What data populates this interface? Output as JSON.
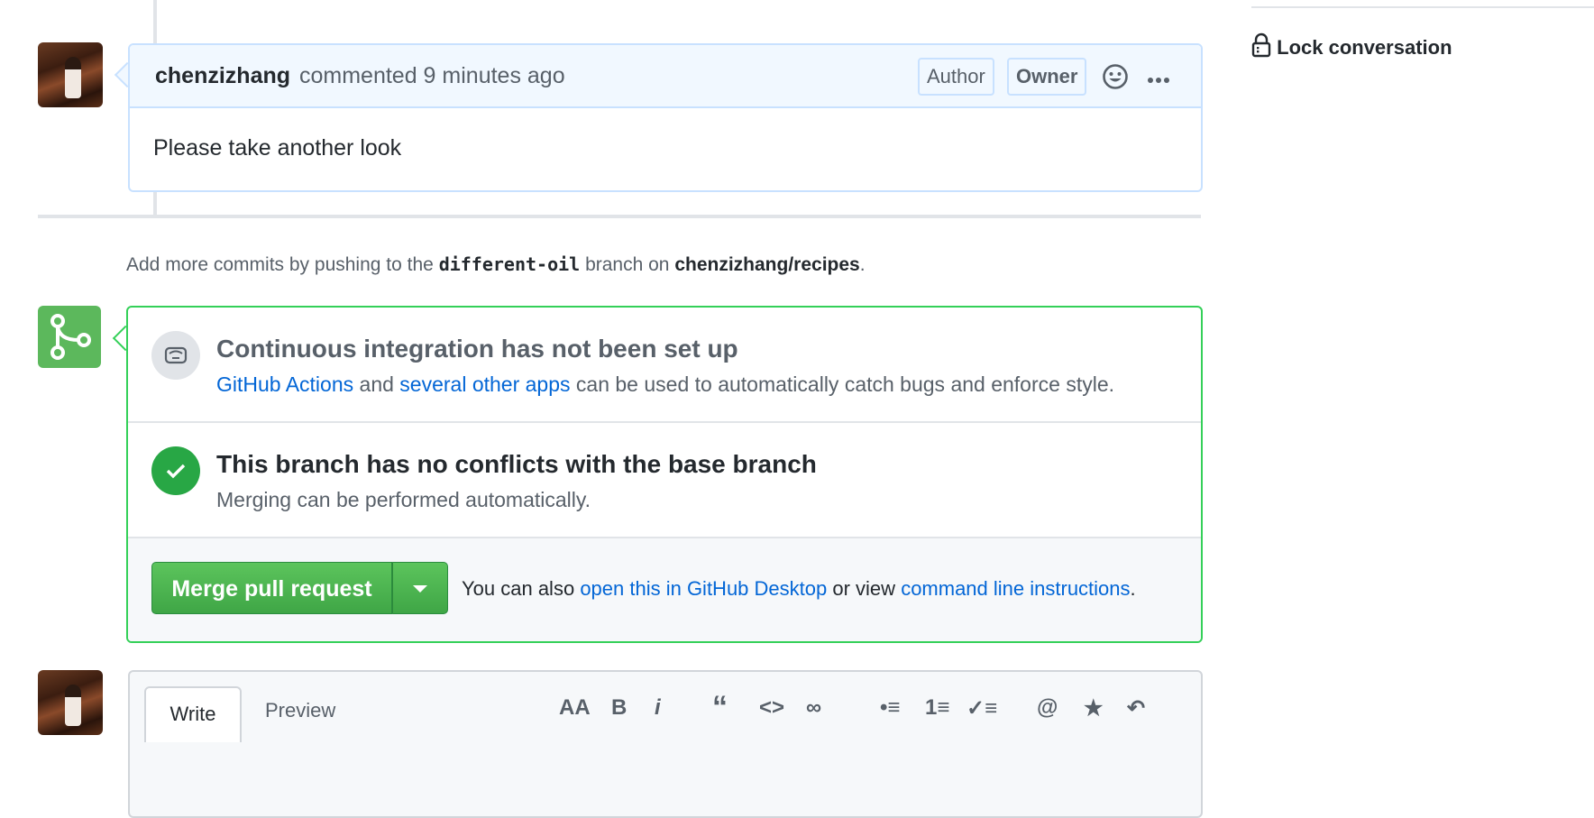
{
  "comment": {
    "author": "chenzizhang",
    "meta": "commented 9 minutes ago",
    "badges": [
      "Author",
      "Owner"
    ],
    "body": "Please take another look"
  },
  "info": {
    "prefix": "Add more commits by pushing to the",
    "branch": "different-oil",
    "middle": "branch on",
    "repo": "chenzizhang/recipes",
    "suffix": "."
  },
  "ci": {
    "title": "Continuous integration has not been set up",
    "link1": "GitHub Actions",
    "and": "and",
    "link2": "several other apps",
    "rest": "can be used to automatically catch bugs and enforce style."
  },
  "conflicts": {
    "title": "This branch has no conflicts with the base branch",
    "desc": "Merging can be performed automatically."
  },
  "merge": {
    "button": "Merge pull request",
    "also_prefix": "You can also",
    "link_desktop": "open this in GitHub Desktop",
    "or_view": "or view",
    "link_cli": "command line instructions",
    "suffix": "."
  },
  "sidebar": {
    "lock_label": "Lock conversation"
  },
  "editor": {
    "tab_write": "Write",
    "tab_preview": "Preview",
    "tools": [
      "AA",
      "B",
      "i",
      "“",
      "<>",
      "∞",
      "•≡",
      "1≡",
      "✓≡",
      "@",
      "★",
      "↶"
    ]
  },
  "colors": {
    "link": "#0366d6",
    "merge_green": "#28a745",
    "header_blue": "#f1f8ff"
  }
}
